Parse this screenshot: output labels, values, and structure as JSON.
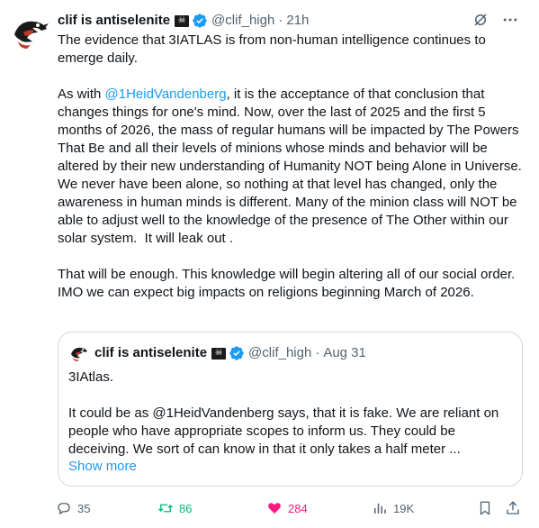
{
  "tweet": {
    "author_name": "clif is antiselenite",
    "handle": "@clif_high",
    "time": "21h",
    "separator": "·",
    "paragraphs": [
      {
        "text": "The evidence that 3IATLAS is from non-human intelligence continues to emerge daily."
      },
      {
        "before": "As with ",
        "mention": "@1HeidVandenberg",
        "after": ", it is the acceptance of that conclusion that changes things for one's mind. Now, over the last of 2025 and the first 5 months of 2026, the mass of regular humans will be impacted by The Powers That Be and all their levels of minions whose minds and behavior will be altered by their new understanding of Humanity NOT being Alone in Universe. We never have been alone, so nothing at that level has changed, only the awareness in human minds is different. Many of the minion class will NOT be able to adjust well to the knowledge of the presence of The Other within our solar system.  It will leak out ."
      },
      {
        "text": "That will be enough. This knowledge will begin altering all of our social order. IMO we can expect big impacts on religions beginning March of 2026."
      }
    ]
  },
  "quote": {
    "author_name": "clif is antiselenite",
    "handle": "@clif_high",
    "separator": "·",
    "time": "Aug 31",
    "line1": "3IAtlas.",
    "line2": "It could be as @1HeidVandenberg says, that it is fake. We are reliant on people who have appropriate scopes to inform us. They could be deceiving. We sort of can know in that it only takes a half meter ...",
    "show_more": "Show more"
  },
  "actions": {
    "replies": "35",
    "reposts": "86",
    "likes": "284",
    "views": "19K"
  },
  "colors": {
    "accent": "#1d9bf0",
    "repost": "#00ba7c",
    "like": "#f91880",
    "secondary_text": "#536471",
    "border": "#cfd9de"
  },
  "icons": {
    "verified": "verified-badge-icon",
    "skull_flag": "pirate-flag-icon",
    "grok": "grok-icon",
    "more": "more-icon",
    "reply": "reply-icon",
    "repost": "repost-icon",
    "like": "heart-icon",
    "views": "views-icon",
    "bookmark": "bookmark-icon",
    "share": "share-icon"
  }
}
